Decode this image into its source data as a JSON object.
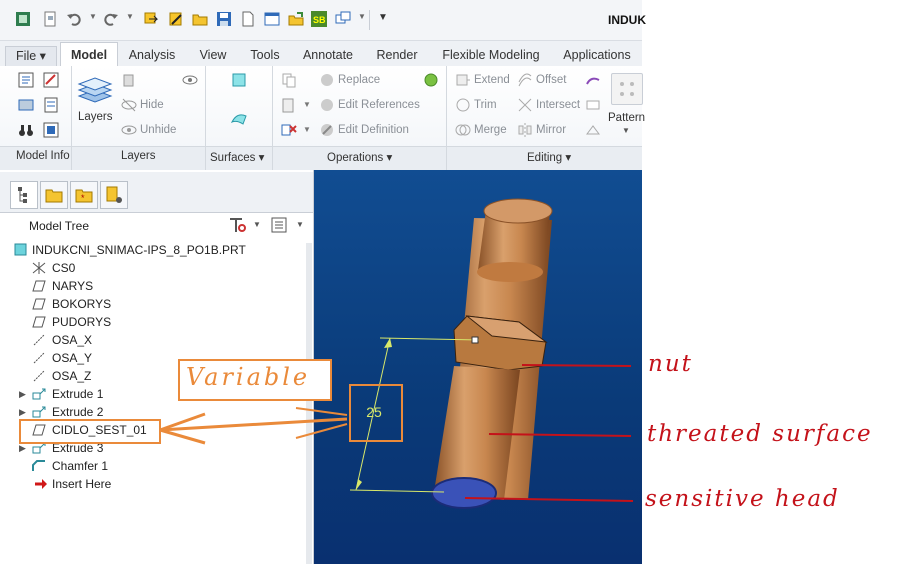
{
  "window": {
    "title": "INDUK"
  },
  "ribbon_tabs": [
    {
      "label": "File ▾"
    },
    {
      "label": "Model"
    },
    {
      "label": "Analysis"
    },
    {
      "label": "View"
    },
    {
      "label": "Tools"
    },
    {
      "label": "Annotate"
    },
    {
      "label": "Render"
    },
    {
      "label": "Flexible Modeling"
    },
    {
      "label": "Applications"
    }
  ],
  "ribbon": {
    "layers": "Layers",
    "hide": "Hide",
    "unhide": "Unhide",
    "replace": "Replace",
    "edit_references": "Edit References",
    "edit_definition": "Edit Definition",
    "extend": "Extend",
    "offset": "Offset",
    "trim": "Trim",
    "intersect": "Intersect",
    "merge": "Merge",
    "mirror": "Mirror",
    "pattern": "Pattern",
    "groups": {
      "model_info": "Model Info",
      "layers": "Layers",
      "surfaces": "Surfaces ▾",
      "operations": "Operations ▾",
      "editing": "Editing ▾"
    }
  },
  "model_tree": {
    "title": "Model Tree",
    "root": "INDUKCNI_SNIMAC-IPS_8_PO1B.PRT",
    "items": [
      {
        "label": "CS0",
        "icon": "csys-icon",
        "expandable": false
      },
      {
        "label": "NARYS",
        "icon": "datum-plane-icon",
        "expandable": false
      },
      {
        "label": "BOKORYS",
        "icon": "datum-plane-icon",
        "expandable": false
      },
      {
        "label": "PUDORYS",
        "icon": "datum-plane-icon",
        "expandable": false
      },
      {
        "label": "OSA_X",
        "icon": "datum-axis-icon",
        "expandable": false
      },
      {
        "label": "OSA_Y",
        "icon": "datum-axis-icon",
        "expandable": false
      },
      {
        "label": "OSA_Z",
        "icon": "datum-axis-icon",
        "expandable": false
      },
      {
        "label": "Extrude 1",
        "icon": "extrude-icon",
        "expandable": true
      },
      {
        "label": "Extrude 2",
        "icon": "extrude-icon",
        "expandable": true
      },
      {
        "label": "CIDLO_SEST_01",
        "icon": "datum-plane-icon",
        "expandable": false
      },
      {
        "label": "Extrude 3",
        "icon": "extrude-icon",
        "expandable": true
      },
      {
        "label": "Chamfer 1",
        "icon": "chamfer-icon",
        "expandable": false
      },
      {
        "label": "Insert Here",
        "icon": "insert-arrow-icon",
        "expandable": false
      }
    ]
  },
  "viewport": {
    "dimension": "25"
  },
  "annotations": {
    "variable": "Variable",
    "nut": "nut",
    "threaded_surface": "threated surface",
    "sensitive_head": "sensitive head"
  },
  "colors": {
    "annotation_orange": "#ea8a3a",
    "annotation_red": "#c4121a",
    "viewport_blue": "#0c4386",
    "part_copper": "#c98a55",
    "head_blue": "#3a52b8"
  }
}
